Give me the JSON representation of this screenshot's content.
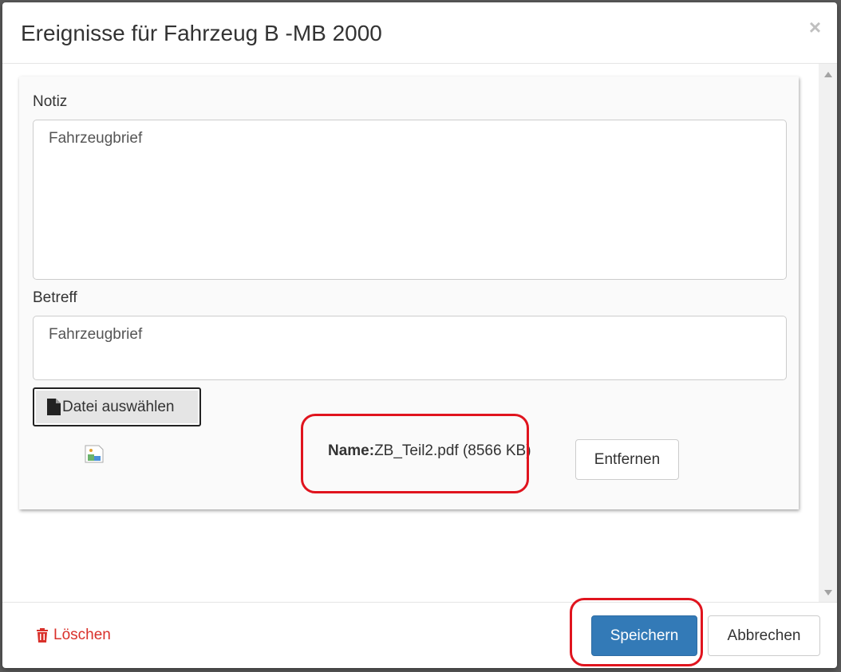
{
  "modal": {
    "title": "Ereignisse für Fahrzeug B -MB 2000",
    "close_symbol": "×"
  },
  "form": {
    "note_label": "Notiz",
    "note_value": "Fahrzeugbrief",
    "subject_label": "Betreff",
    "subject_value": "Fahrzeugbrief",
    "file_button_label": "Datei auswählen",
    "file_icon": "file-icon"
  },
  "attachment": {
    "name_label": "Name:",
    "name_value": "ZB_Teil2.pdf (8566 KB)",
    "remove_label": "Entfernen",
    "preview_icon": "broken-image-icon"
  },
  "footer": {
    "delete_label": "Löschen",
    "delete_icon": "trash-icon",
    "save_label": "Speichern",
    "cancel_label": "Abbrechen"
  },
  "colors": {
    "primary": "#337ab7",
    "danger": "#d9302a",
    "highlight": "#e0141e"
  }
}
